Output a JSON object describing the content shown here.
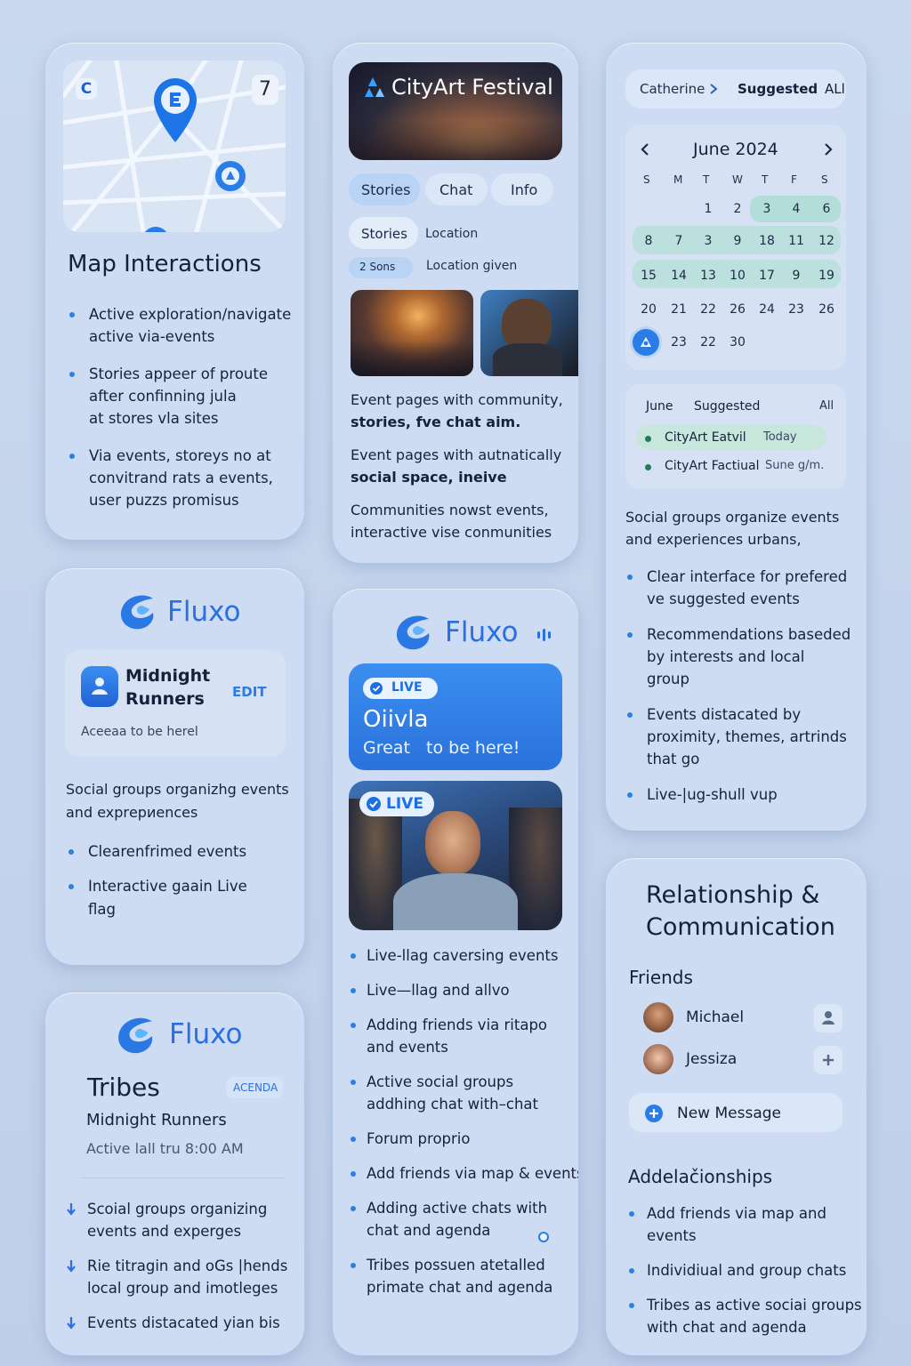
{
  "map_card": {
    "map_left_icon": "C",
    "map_right_badge": "7",
    "title": "Map Interactions",
    "bullets": [
      [
        "Active exploration/navigate",
        "active via-events"
      ],
      [
        "Stories appeer of proute",
        "after confinning јula",
        "at stores vla sites"
      ],
      [
        "Via events, storeys no at",
        "convitrand rats a events,",
        "user puzzs promisus"
      ]
    ]
  },
  "festival_card": {
    "title": "CityArt Festival",
    "tabs": [
      "Stories",
      "Chat",
      "Info"
    ],
    "row1": {
      "pill": "Stories",
      "label": "Location"
    },
    "row2": {
      "pill": "2 Sons",
      "label": "Location given"
    },
    "p1": [
      "Event pages with community,",
      "stories, fve chat aim."
    ],
    "p2": [
      "Event pages with autnatically",
      "social space, ineive"
    ],
    "p3": [
      "Communities nowst events,",
      "interactive vise conmunities"
    ]
  },
  "calendar_card": {
    "breadcrumb": {
      "name": "Catherine",
      "current": "Suggested",
      "all": "ALl"
    },
    "month": "June 2024",
    "weekdays": [
      "S",
      "M",
      "T",
      "W",
      "T",
      "F",
      "S"
    ],
    "rows": [
      [
        "",
        "",
        "1",
        "2",
        "3",
        "4",
        "6"
      ],
      [
        "8",
        "7",
        "3",
        "9",
        "18",
        "11",
        "12"
      ],
      [
        "15",
        "14",
        "13",
        "10",
        "17",
        "9",
        "19"
      ],
      [
        "20",
        "21",
        "22",
        "26",
        "24",
        "23",
        "26"
      ],
      [
        "",
        "23",
        "22",
        "30",
        "",
        "",
        ""
      ]
    ],
    "list_header": {
      "month": "June",
      "suggested": "Suggested",
      "all": "All"
    },
    "events": [
      {
        "name": "CityArt Eatvil",
        "when": "Today"
      },
      {
        "name": "CityArt Factiual",
        "when": "Sune g/m."
      }
    ],
    "intro": [
      "Social groups organize events",
      "and experiences urbans,"
    ],
    "bullets": [
      [
        "Clear interface for prefered",
        "ve suggested events"
      ],
      [
        "Recommendations baseded",
        "by interests and local",
        "group"
      ],
      [
        "Events distacated by",
        "proximity, themes, artrinds",
        "that go"
      ],
      [
        "Live-|ug-shull vup"
      ]
    ]
  },
  "fluxo1_card": {
    "brand": "Fluxo",
    "group_name": [
      "Midnight",
      "Runners"
    ],
    "edit_label": "EDIT",
    "status": "Aceeaa to be herel",
    "intro": [
      "Social groups organizhg events",
      "and exprериences"
    ],
    "bullets": [
      [
        "Clearenfrimed events"
      ],
      [
        "Interactive gaain Live",
        "flag"
      ]
    ]
  },
  "live_card": {
    "brand": "Fluxo",
    "live_label": "LIVE",
    "banner_title": "Oiivla",
    "banner_sub": "Great   to be here!",
    "photo_live_label": "LIVE",
    "bullets": [
      [
        "Live-llag caversing events"
      ],
      [
        "Live—llag and allvo"
      ],
      [
        "Adding friends via ritapo",
        "and events"
      ],
      [
        "Active social groups",
        "addhing chat with–chat"
      ],
      [
        "Forum proprio"
      ],
      [
        "Add friends via map & events"
      ],
      [
        "Adding active chats with",
        "chat and agenda"
      ],
      [
        "Tribes possuen atetalled",
        "primate chat and agenda"
      ]
    ]
  },
  "tribes_card": {
    "brand": "Fluxo",
    "title": "Tribes",
    "badge": "ACENDA",
    "group": "Midnight Runners",
    "time": "Active lall tru 8:00 AM",
    "bullets": [
      [
        "Scoial groups organizing",
        "events and experges"
      ],
      [
        "Rie titragin and oGs |hends",
        "local group and imotleges"
      ],
      [
        "Events distacated yian bis"
      ]
    ]
  },
  "relationship_card": {
    "title": [
      "Relationship &",
      "Communication"
    ],
    "friends_label": "Friends",
    "friends": [
      "Michael",
      "Jessiza"
    ],
    "new_message": "New Message",
    "section2": "Addelačionships",
    "bullets": [
      [
        "Add friends via map and",
        "events"
      ],
      [
        "Individiual and group chats"
      ],
      [
        "Tribes as active sociai groups",
        "with chat and agenda"
      ]
    ]
  },
  "colors": {
    "accent": "#2d7fe0",
    "card": "#cddcf2",
    "background": "#c7d6ed"
  }
}
